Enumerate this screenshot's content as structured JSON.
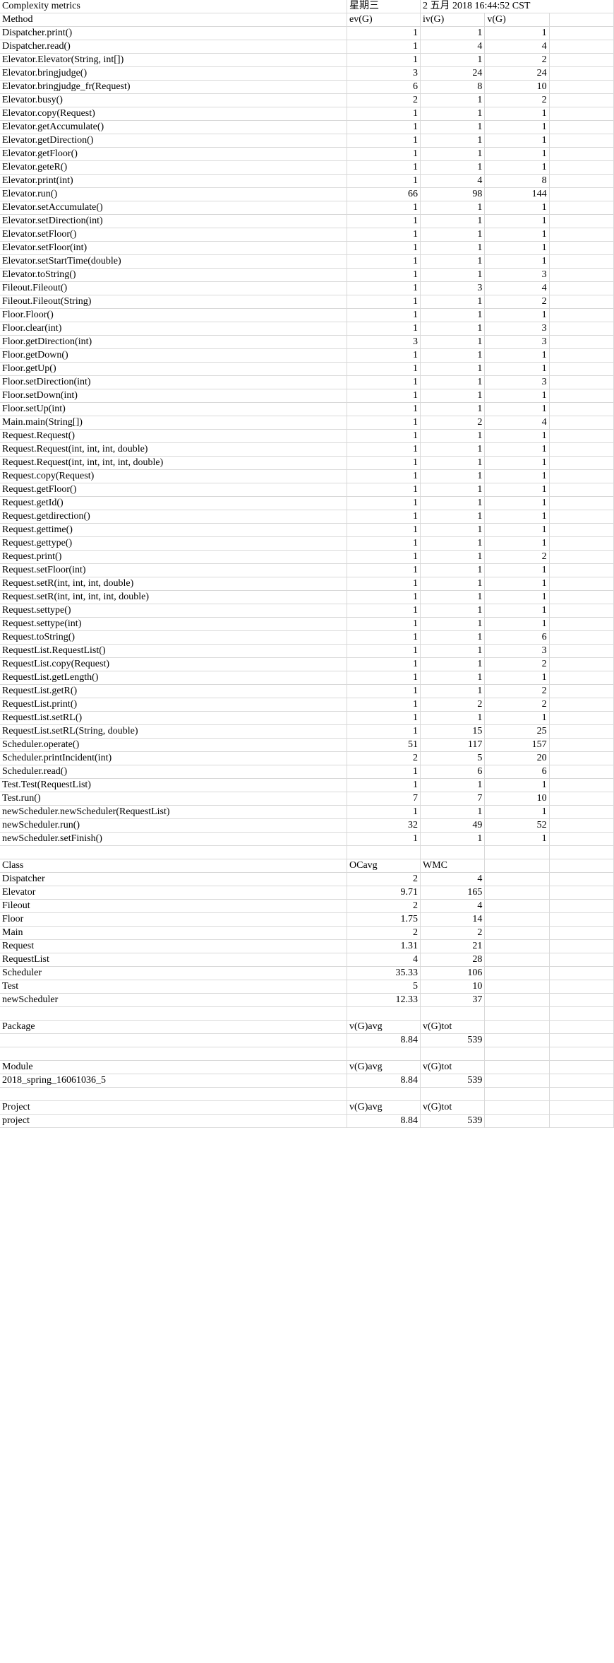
{
  "report": {
    "title": "Complexity metrics",
    "weekday": "星期三",
    "datetime": "2 五月 2018 16:44:52 CST"
  },
  "method_table": {
    "headers": {
      "name": "Method",
      "ev": "ev(G)",
      "iv": "iv(G)",
      "v": "v(G)",
      "blank": ""
    },
    "rows": [
      {
        "name": "Dispatcher.print()",
        "ev": "1",
        "iv": "1",
        "v": "1"
      },
      {
        "name": "Dispatcher.read()",
        "ev": "1",
        "iv": "4",
        "v": "4"
      },
      {
        "name": "Elevator.Elevator(String, int[])",
        "ev": "1",
        "iv": "1",
        "v": "2"
      },
      {
        "name": "Elevator.bringjudge()",
        "ev": "3",
        "iv": "24",
        "v": "24"
      },
      {
        "name": "Elevator.bringjudge_fr(Request)",
        "ev": "6",
        "iv": "8",
        "v": "10"
      },
      {
        "name": "Elevator.busy()",
        "ev": "2",
        "iv": "1",
        "v": "2"
      },
      {
        "name": "Elevator.copy(Request)",
        "ev": "1",
        "iv": "1",
        "v": "1"
      },
      {
        "name": "Elevator.getAccumulate()",
        "ev": "1",
        "iv": "1",
        "v": "1"
      },
      {
        "name": "Elevator.getDirection()",
        "ev": "1",
        "iv": "1",
        "v": "1"
      },
      {
        "name": "Elevator.getFloor()",
        "ev": "1",
        "iv": "1",
        "v": "1"
      },
      {
        "name": "Elevator.geteR()",
        "ev": "1",
        "iv": "1",
        "v": "1"
      },
      {
        "name": "Elevator.print(int)",
        "ev": "1",
        "iv": "4",
        "v": "8"
      },
      {
        "name": "Elevator.run()",
        "ev": "66",
        "iv": "98",
        "v": "144"
      },
      {
        "name": "Elevator.setAccumulate()",
        "ev": "1",
        "iv": "1",
        "v": "1"
      },
      {
        "name": "Elevator.setDirection(int)",
        "ev": "1",
        "iv": "1",
        "v": "1"
      },
      {
        "name": "Elevator.setFloor()",
        "ev": "1",
        "iv": "1",
        "v": "1"
      },
      {
        "name": "Elevator.setFloor(int)",
        "ev": "1",
        "iv": "1",
        "v": "1"
      },
      {
        "name": "Elevator.setStartTime(double)",
        "ev": "1",
        "iv": "1",
        "v": "1"
      },
      {
        "name": "Elevator.toString()",
        "ev": "1",
        "iv": "1",
        "v": "3"
      },
      {
        "name": "Fileout.Fileout()",
        "ev": "1",
        "iv": "3",
        "v": "4"
      },
      {
        "name": "Fileout.Fileout(String)",
        "ev": "1",
        "iv": "1",
        "v": "2"
      },
      {
        "name": "Floor.Floor()",
        "ev": "1",
        "iv": "1",
        "v": "1"
      },
      {
        "name": "Floor.clear(int)",
        "ev": "1",
        "iv": "1",
        "v": "3"
      },
      {
        "name": "Floor.getDirection(int)",
        "ev": "3",
        "iv": "1",
        "v": "3"
      },
      {
        "name": "Floor.getDown()",
        "ev": "1",
        "iv": "1",
        "v": "1"
      },
      {
        "name": "Floor.getUp()",
        "ev": "1",
        "iv": "1",
        "v": "1"
      },
      {
        "name": "Floor.setDirection(int)",
        "ev": "1",
        "iv": "1",
        "v": "3"
      },
      {
        "name": "Floor.setDown(int)",
        "ev": "1",
        "iv": "1",
        "v": "1"
      },
      {
        "name": "Floor.setUp(int)",
        "ev": "1",
        "iv": "1",
        "v": "1"
      },
      {
        "name": "Main.main(String[])",
        "ev": "1",
        "iv": "2",
        "v": "4"
      },
      {
        "name": "Request.Request()",
        "ev": "1",
        "iv": "1",
        "v": "1"
      },
      {
        "name": "Request.Request(int, int, int, double)",
        "ev": "1",
        "iv": "1",
        "v": "1"
      },
      {
        "name": "Request.Request(int, int, int, int, double)",
        "ev": "1",
        "iv": "1",
        "v": "1"
      },
      {
        "name": "Request.copy(Request)",
        "ev": "1",
        "iv": "1",
        "v": "1"
      },
      {
        "name": "Request.getFloor()",
        "ev": "1",
        "iv": "1",
        "v": "1"
      },
      {
        "name": "Request.getId()",
        "ev": "1",
        "iv": "1",
        "v": "1"
      },
      {
        "name": "Request.getdirection()",
        "ev": "1",
        "iv": "1",
        "v": "1"
      },
      {
        "name": "Request.gettime()",
        "ev": "1",
        "iv": "1",
        "v": "1"
      },
      {
        "name": "Request.gettype()",
        "ev": "1",
        "iv": "1",
        "v": "1"
      },
      {
        "name": "Request.print()",
        "ev": "1",
        "iv": "1",
        "v": "2"
      },
      {
        "name": "Request.setFloor(int)",
        "ev": "1",
        "iv": "1",
        "v": "1"
      },
      {
        "name": "Request.setR(int, int, int, double)",
        "ev": "1",
        "iv": "1",
        "v": "1"
      },
      {
        "name": "Request.setR(int, int, int, int, double)",
        "ev": "1",
        "iv": "1",
        "v": "1"
      },
      {
        "name": "Request.settype()",
        "ev": "1",
        "iv": "1",
        "v": "1"
      },
      {
        "name": "Request.settype(int)",
        "ev": "1",
        "iv": "1",
        "v": "1"
      },
      {
        "name": "Request.toString()",
        "ev": "1",
        "iv": "1",
        "v": "6"
      },
      {
        "name": "RequestList.RequestList()",
        "ev": "1",
        "iv": "1",
        "v": "3"
      },
      {
        "name": "RequestList.copy(Request)",
        "ev": "1",
        "iv": "1",
        "v": "2"
      },
      {
        "name": "RequestList.getLength()",
        "ev": "1",
        "iv": "1",
        "v": "1"
      },
      {
        "name": "RequestList.getR()",
        "ev": "1",
        "iv": "1",
        "v": "2"
      },
      {
        "name": "RequestList.print()",
        "ev": "1",
        "iv": "2",
        "v": "2"
      },
      {
        "name": "RequestList.setRL()",
        "ev": "1",
        "iv": "1",
        "v": "1"
      },
      {
        "name": "RequestList.setRL(String, double)",
        "ev": "1",
        "iv": "15",
        "v": "25"
      },
      {
        "name": "Scheduler.operate()",
        "ev": "51",
        "iv": "117",
        "v": "157"
      },
      {
        "name": "Scheduler.printIncident(int)",
        "ev": "2",
        "iv": "5",
        "v": "20"
      },
      {
        "name": "Scheduler.read()",
        "ev": "1",
        "iv": "6",
        "v": "6"
      },
      {
        "name": "Test.Test(RequestList)",
        "ev": "1",
        "iv": "1",
        "v": "1"
      },
      {
        "name": "Test.run()",
        "ev": "7",
        "iv": "7",
        "v": "10"
      },
      {
        "name": "newScheduler.newScheduler(RequestList)",
        "ev": "1",
        "iv": "1",
        "v": "1"
      },
      {
        "name": "newScheduler.run()",
        "ev": "32",
        "iv": "49",
        "v": "52"
      },
      {
        "name": "newScheduler.setFinish()",
        "ev": "1",
        "iv": "1",
        "v": "1"
      }
    ]
  },
  "class_table": {
    "headers": {
      "name": "Class",
      "ocavg": "OCavg",
      "wmc": "WMC"
    },
    "rows": [
      {
        "name": "Dispatcher",
        "ocavg": "2",
        "wmc": "4"
      },
      {
        "name": "Elevator",
        "ocavg": "9.71",
        "wmc": "165"
      },
      {
        "name": "Fileout",
        "ocavg": "2",
        "wmc": "4"
      },
      {
        "name": "Floor",
        "ocavg": "1.75",
        "wmc": "14"
      },
      {
        "name": "Main",
        "ocavg": "2",
        "wmc": "2"
      },
      {
        "name": "Request",
        "ocavg": "1.31",
        "wmc": "21"
      },
      {
        "name": "RequestList",
        "ocavg": "4",
        "wmc": "28"
      },
      {
        "name": "Scheduler",
        "ocavg": "35.33",
        "wmc": "106"
      },
      {
        "name": "Test",
        "ocavg": "5",
        "wmc": "10"
      },
      {
        "name": "newScheduler",
        "ocavg": "12.33",
        "wmc": "37"
      }
    ]
  },
  "package_table": {
    "headers": {
      "name": "Package",
      "vgavg": "v(G)avg",
      "vgtot": "v(G)tot"
    },
    "rows": [
      {
        "name": "",
        "vgavg": "8.84",
        "vgtot": "539"
      }
    ]
  },
  "module_table": {
    "headers": {
      "name": "Module",
      "vgavg": "v(G)avg",
      "vgtot": "v(G)tot"
    },
    "rows": [
      {
        "name": "2018_spring_16061036_5",
        "vgavg": "8.84",
        "vgtot": "539"
      }
    ]
  },
  "project_table": {
    "headers": {
      "name": "Project",
      "vgavg": "v(G)avg",
      "vgtot": "v(G)tot"
    },
    "rows": [
      {
        "name": "project",
        "vgavg": "8.84",
        "vgtot": "539"
      }
    ]
  }
}
